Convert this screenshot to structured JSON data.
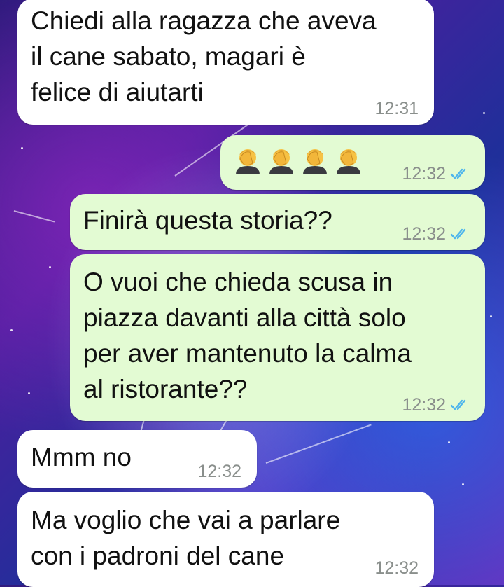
{
  "chat": {
    "messages": [
      {
        "direction": "incoming",
        "text": "Chiedi alla ragazza che aveva\nil cane sabato, magari è\nfelice di aiutarti",
        "time": "12:31"
      },
      {
        "direction": "outgoing",
        "emoji": [
          "facepalm-emoji",
          "facepalm-emoji",
          "facepalm-emoji",
          "facepalm-emoji"
        ],
        "time": "12:32",
        "status": "read"
      },
      {
        "direction": "outgoing",
        "text": "Finirà questa storia??",
        "time": "12:32",
        "status": "read"
      },
      {
        "direction": "outgoing",
        "text": "O vuoi che chieda scusa in\npiazza davanti alla città solo\nper aver mantenuto la calma\nal ristorante??",
        "time": "12:32",
        "status": "read"
      },
      {
        "direction": "incoming",
        "text": "Mmm no",
        "time": "12:32"
      },
      {
        "direction": "incoming",
        "text": "Ma voglio che vai a parlare\ncon i padroni del cane",
        "time": "12:32"
      }
    ]
  },
  "colors": {
    "incoming_bubble": "#ffffff",
    "outgoing_bubble": "#e3fbd3",
    "read_ticks": "#4fb6ec",
    "timestamp": "#8a8f8c"
  }
}
